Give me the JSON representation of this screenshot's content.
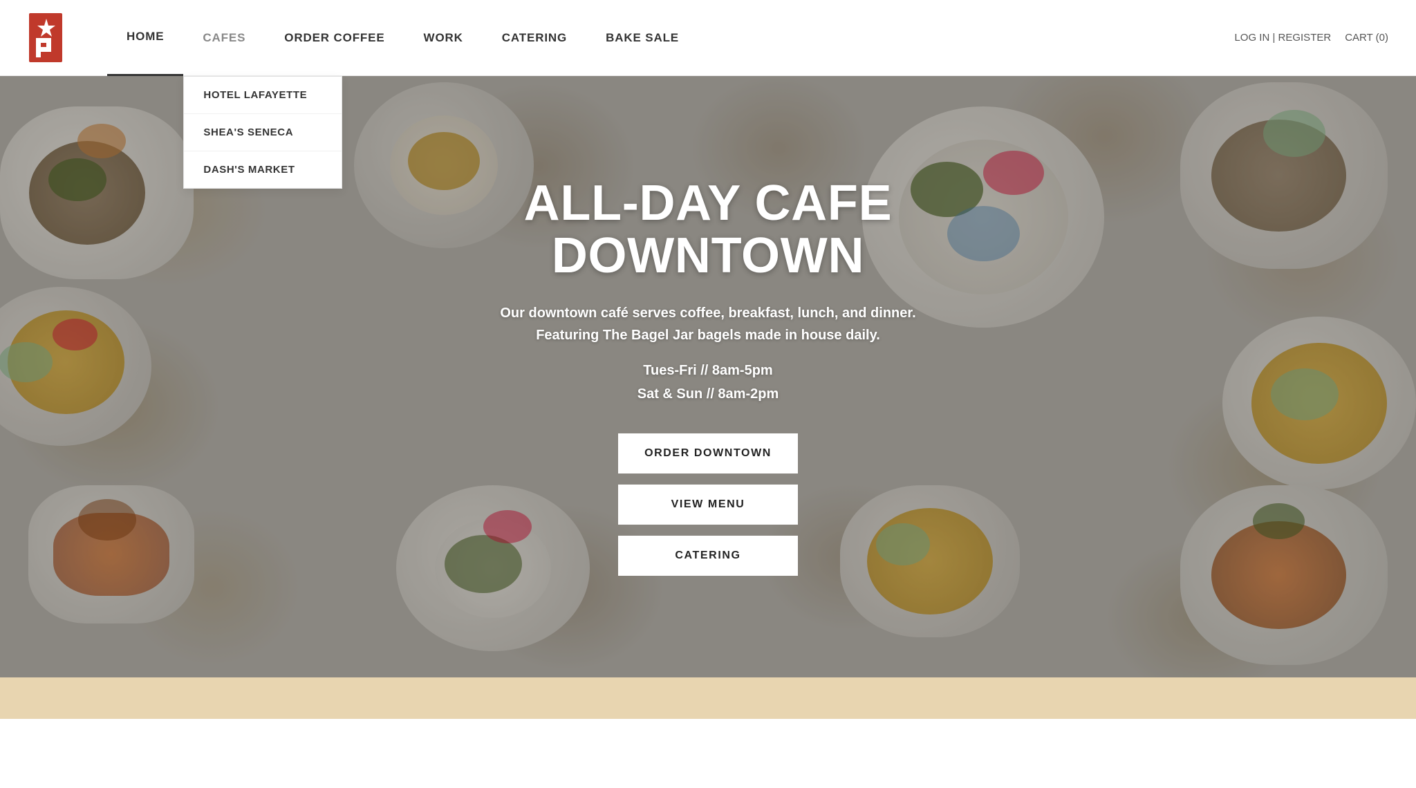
{
  "header": {
    "logo_alt": "P Logo",
    "nav_items": [
      {
        "id": "home",
        "label": "HOME",
        "active": true
      },
      {
        "id": "cafes",
        "label": "CAFES",
        "active": false,
        "has_dropdown": true
      },
      {
        "id": "order-coffee",
        "label": "ORDER COFFEE",
        "active": false
      },
      {
        "id": "work",
        "label": "WORK",
        "active": false
      },
      {
        "id": "catering",
        "label": "CATERING",
        "active": false
      },
      {
        "id": "bake-sale",
        "label": "BAKE SALE",
        "active": false
      }
    ],
    "auth_label": "LOG IN | REGISTER",
    "cart_label": "CART (0)"
  },
  "cafes_dropdown": {
    "items": [
      {
        "id": "hotel-lafayette",
        "label": "HOTEL LAFAYETTE"
      },
      {
        "id": "sheas-seneca",
        "label": "SHEA'S SENECA"
      },
      {
        "id": "dashs-market",
        "label": "DASH'S MARKET"
      }
    ]
  },
  "hero": {
    "title": "ALL-DAY CAFE DOWNTOWN",
    "subtitle_line1": "Our downtown café serves coffee, breakfast, lunch, and dinner.",
    "subtitle_line2": "Featuring The Bagel Jar bagels made in house daily.",
    "hours_line1": "Tues-Fri // 8am-5pm",
    "hours_line2": "Sat & Sun // 8am-2pm",
    "buttons": [
      {
        "id": "order-downtown",
        "label": "ORDER DOWNTOWN"
      },
      {
        "id": "view-menu",
        "label": "VIEW MENU"
      },
      {
        "id": "catering",
        "label": "CATERING"
      }
    ]
  },
  "colors": {
    "accent_red": "#c0392b",
    "nav_active_border": "#333",
    "hero_bg": "#b8b4ac",
    "bottom_bar": "#e8d5b0"
  }
}
